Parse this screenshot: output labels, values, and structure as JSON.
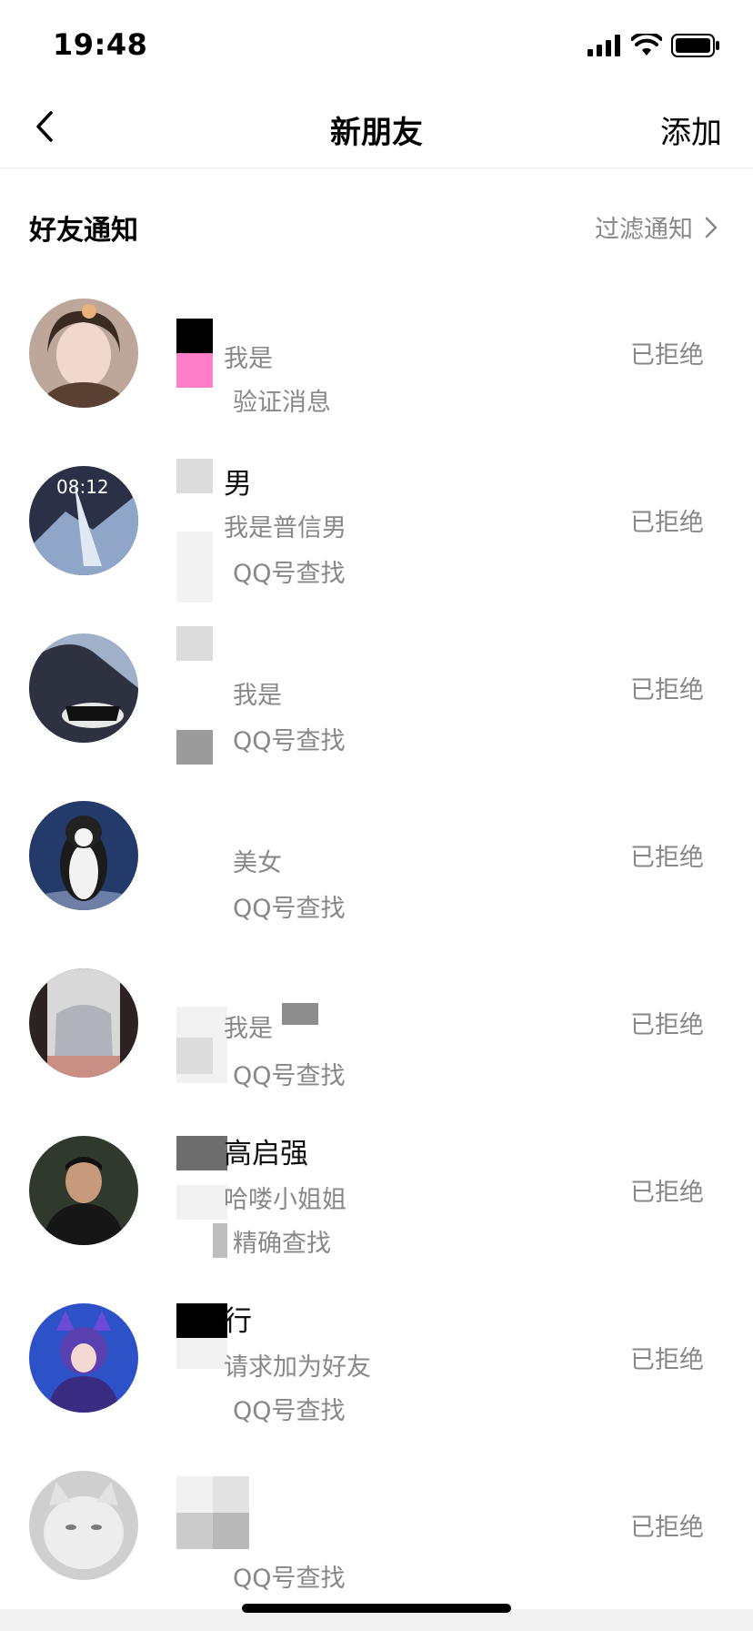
{
  "status_bar": {
    "time": "19:48"
  },
  "nav": {
    "title": "新朋友",
    "add_label": "添加",
    "back_icon": "chevron-left-icon"
  },
  "section": {
    "title": "好友通知",
    "filter_label": "过滤通知"
  },
  "requests": [
    {
      "name": "",
      "message": "我是",
      "source": "验证消息",
      "status": "已拒绝"
    },
    {
      "name": "男",
      "message": "我是普信男",
      "source": "QQ号查找",
      "status": "已拒绝"
    },
    {
      "name": "",
      "message": "我是",
      "source": "QQ号查找",
      "status": "已拒绝"
    },
    {
      "name": "",
      "message": "美女",
      "source": "QQ号查找",
      "status": "已拒绝"
    },
    {
      "name": "",
      "message": "我是",
      "source": "QQ号查找",
      "status": "已拒绝"
    },
    {
      "name": "高启强",
      "message": "哈喽小姐姐",
      "source": "精确查找",
      "status": "已拒绝"
    },
    {
      "name": "行",
      "message": "请求加为好友",
      "source": "QQ号查找",
      "status": "已拒绝"
    },
    {
      "name": "",
      "message": "",
      "source": "QQ号查找",
      "status": "已拒绝"
    }
  ]
}
